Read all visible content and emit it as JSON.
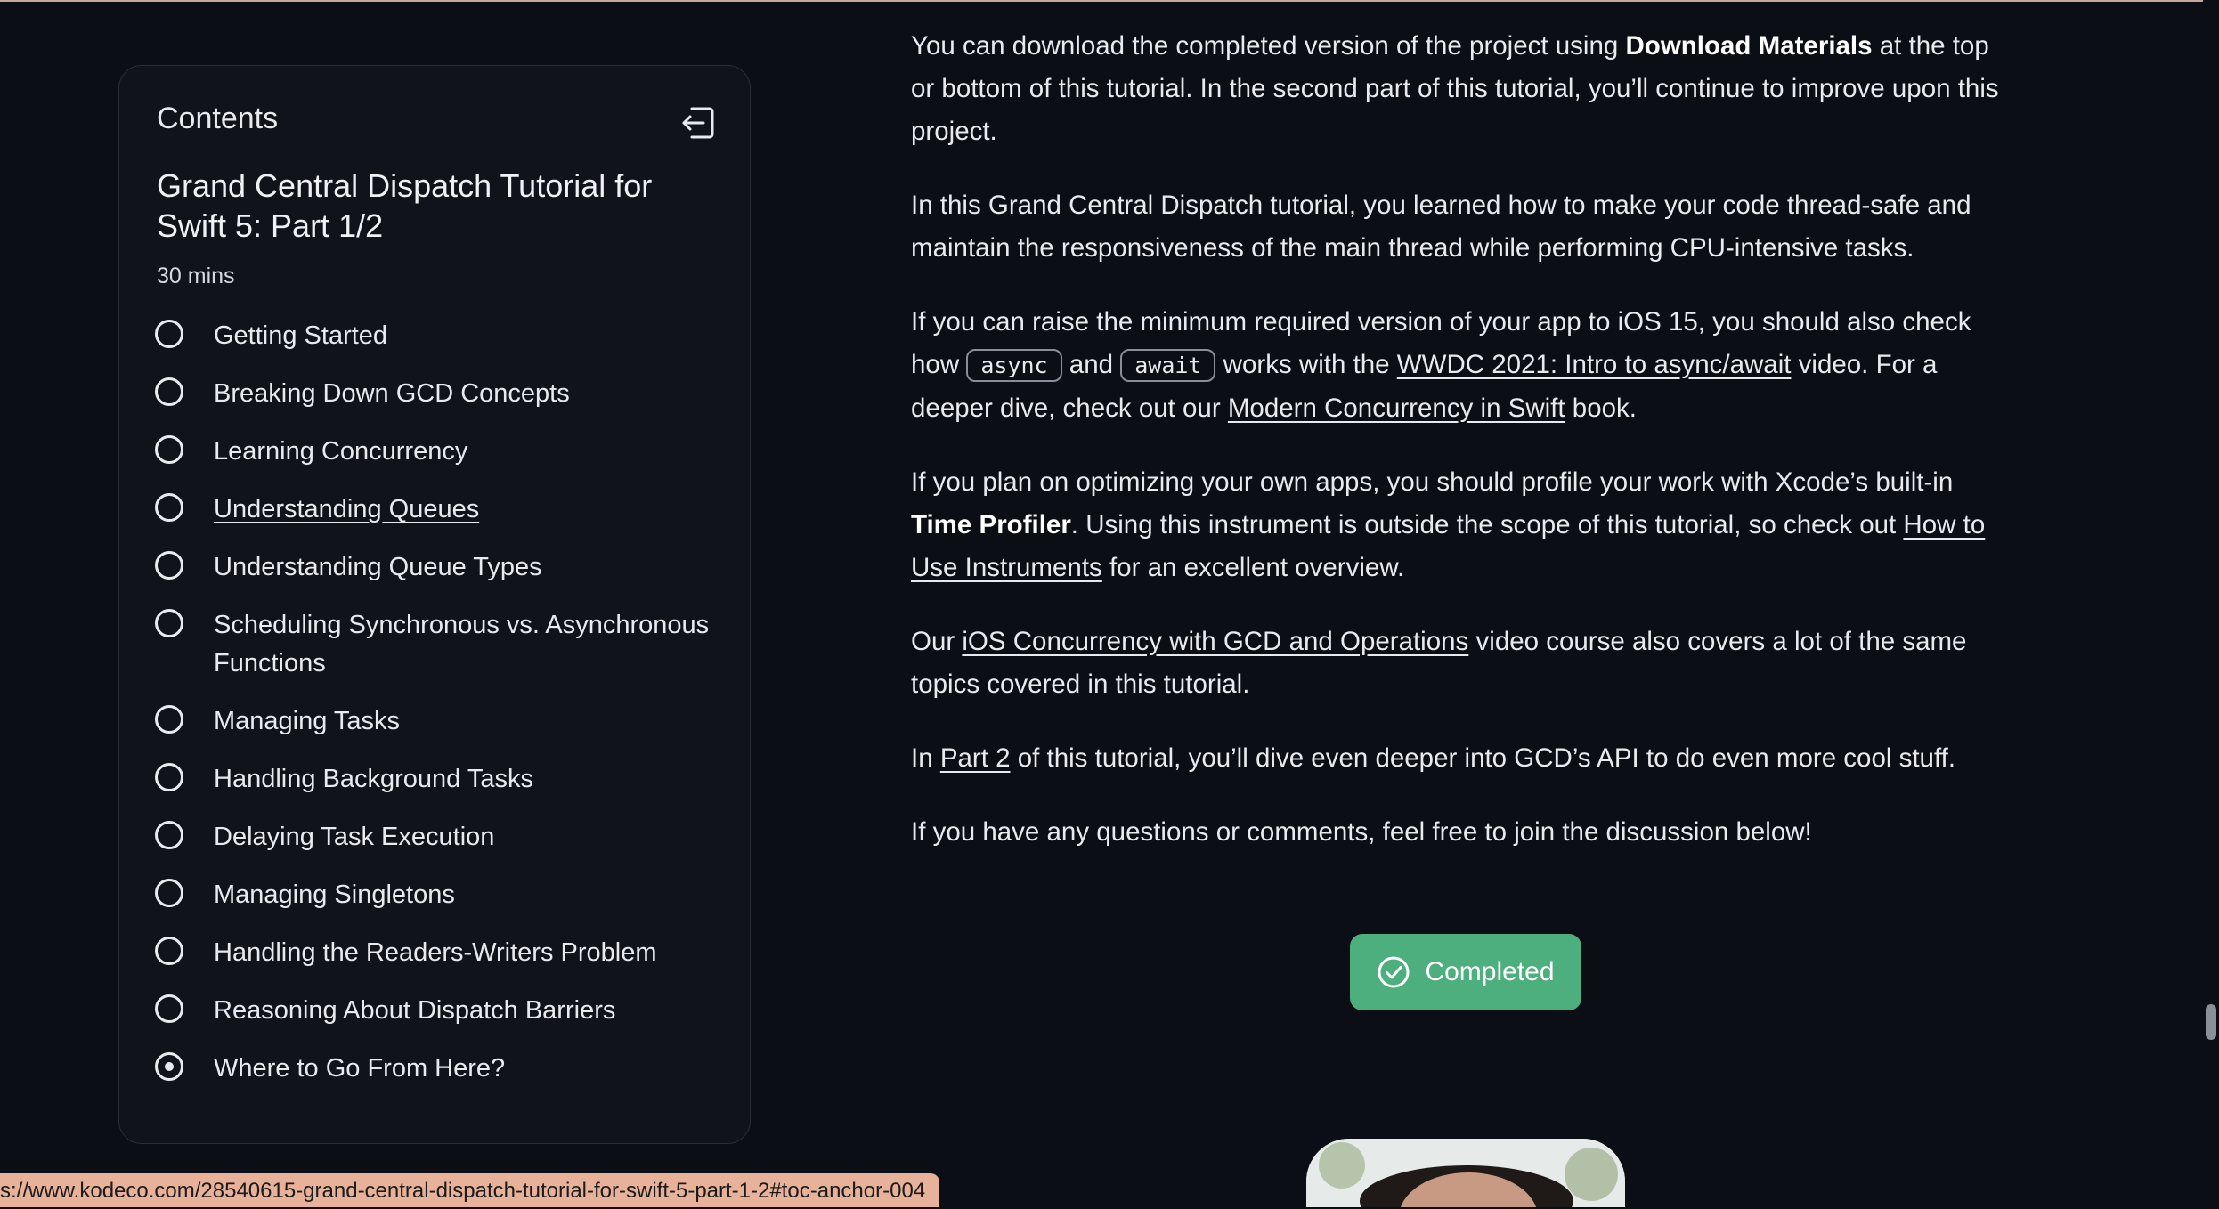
{
  "sidebar": {
    "heading": "Contents",
    "collapse_icon": "collapse-left-icon",
    "title": "Grand Central Dispatch Tutorial for Swift 5: Part 1/2",
    "duration": "30 mins",
    "items": [
      {
        "label": "Getting Started"
      },
      {
        "label": "Breaking Down GCD Concepts"
      },
      {
        "label": "Learning Concurrency"
      },
      {
        "label": "Understanding Queues"
      },
      {
        "label": "Understanding Queue Types"
      },
      {
        "label": "Scheduling Synchronous vs. Asynchronous Functions"
      },
      {
        "label": "Managing Tasks"
      },
      {
        "label": "Handling Background Tasks"
      },
      {
        "label": "Delaying Task Execution"
      },
      {
        "label": "Managing Singletons"
      },
      {
        "label": "Handling the Readers-Writers Problem"
      },
      {
        "label": "Reasoning About Dispatch Barriers"
      },
      {
        "label": "Where to Go From Here?"
      }
    ]
  },
  "article": {
    "p1": {
      "a": "You can download the completed version of the project using ",
      "bold": "Download Materials",
      "b": " at the top or bottom of this tutorial. In the second part of this tutorial, you’ll continue to improve upon this project."
    },
    "p2": "In this Grand Central Dispatch tutorial, you learned how to make your code thread-safe and maintain the responsiveness of the main thread while performing CPU-intensive tasks.",
    "p3": {
      "a": "If you can raise the minimum required version of your app to iOS 15, you should also check how ",
      "code1": "async",
      "b": " and ",
      "code2": "await",
      "c": " works with the ",
      "link1": "WWDC 2021: Intro to async/await",
      "d": " video. For a deeper dive, check out our ",
      "link2": "Modern Concurrency in Swift",
      "e": " book."
    },
    "p4": {
      "a": "If you plan on optimizing your own apps, you should profile your work with Xcode’s built-in ",
      "bold": "Time Profiler",
      "b": ". Using this instrument is outside the scope of this tutorial, so check out ",
      "link": "How to Use Instruments",
      "c": " for an excellent overview."
    },
    "p5": {
      "a": "Our ",
      "link": "iOS Concurrency with GCD and Operations",
      "b": " video course also covers a lot of the same topics covered in this tutorial."
    },
    "p6": {
      "a": "In ",
      "link": "Part 2",
      "b": " of this tutorial, you’ll dive even deeper into GCD’s API to do even more cool stuff."
    },
    "p7": "If you have any questions or comments, feel free to join the discussion below!"
  },
  "completed_button": {
    "label": "Completed",
    "icon": "check-circle-icon",
    "color": "#4caf7d"
  },
  "status_bar": {
    "url": "s://www.kodeco.com/28540615-grand-central-dispatch-tutorial-for-swift-5-part-1-2#toc-anchor-004"
  },
  "colors": {
    "background": "#0b0e14",
    "panel": "#10131a",
    "accent": "#4caf7d"
  }
}
